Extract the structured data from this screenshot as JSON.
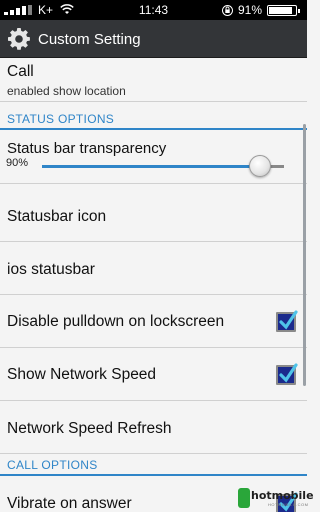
{
  "status_bar": {
    "carrier": "K+",
    "time": "11:43",
    "battery_percent": "91%",
    "battery_level": 0.91,
    "icons": [
      "signal-icon",
      "wifi-icon",
      "rotation-lock-icon",
      "battery-icon"
    ]
  },
  "action_bar": {
    "icon": "gear-icon",
    "title": "Custom Setting"
  },
  "call_item": {
    "title": "Call",
    "summary": "enabled show location"
  },
  "sections": {
    "status_options": "STATUS OPTIONS",
    "call_options": "CALL OPTIONS"
  },
  "transparency": {
    "title": "Status bar transparency",
    "value_label": "90%",
    "value": 90
  },
  "items": {
    "statusbar_icon": "Statusbar icon",
    "ios_statusbar": "ios statusbar",
    "disable_pulldown": "Disable pulldown on lockscreen",
    "show_network_speed": "Show Network Speed",
    "network_speed_refresh": "Network Speed Refresh",
    "vibrate_on_answer": "Vibrate on answer"
  },
  "checkboxes": {
    "disable_pulldown": true,
    "show_network_speed": true,
    "vibrate_on_answer": true
  },
  "watermark": {
    "text": "hotmobile",
    "sub": "HOTMOBILE.COM"
  },
  "colors": {
    "accent": "#2f85c8",
    "action_bar": "#333538",
    "checkbox_fill": "#1b2a8c",
    "check_mark": "#4fc3e8"
  }
}
